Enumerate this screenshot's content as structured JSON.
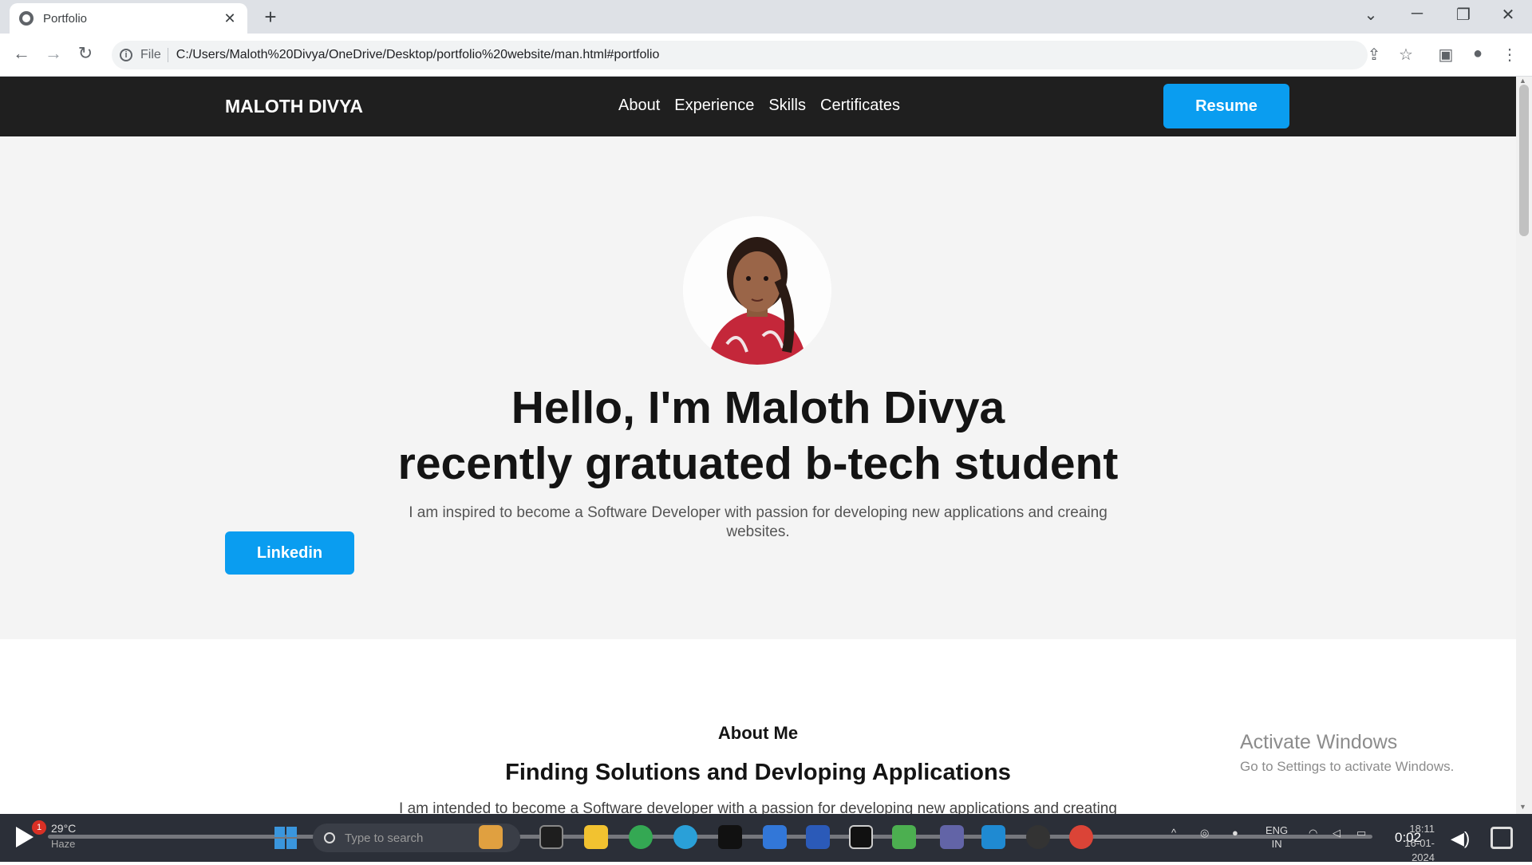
{
  "browser": {
    "tab_title": "Portfolio",
    "url_scheme": "File",
    "url": "C:/Users/Maloth%20Divya/OneDrive/Desktop/portfolio%20website/man.html#portfolio"
  },
  "site": {
    "brand": "MALOTH DIVYA",
    "nav_links": [
      "About",
      "Experience",
      "Skills",
      "Certificates"
    ],
    "resume_label": "Resume"
  },
  "hero": {
    "title_line1": "Hello, I'm Maloth Divya",
    "title_line2": "recently gratuated b-tech student",
    "text": "I am inspired to become a Software Developer with passion for developing new applications and creaing websites.",
    "linkedin_label": "Linkedin"
  },
  "about": {
    "eyebrow": "About Me",
    "title": "Finding Solutions and Devloping Applications",
    "text": "I am intended to become a Software developer with a passion for developing new applications and creating"
  },
  "watermark": {
    "line1": "Activate Windows",
    "line2": "Go to Settings to activate Windows."
  },
  "taskbar": {
    "weather_badge": "1",
    "weather_temp": "29°C",
    "weather_desc": "Haze",
    "search_placeholder": "Type to search",
    "lang_line1": "ENG",
    "lang_line2": "IN",
    "clock_time": "18:11",
    "clock_date": "16-01-2024",
    "video_time": "0:02"
  },
  "colors": {
    "accent": "#0a9df0",
    "nav_bg": "#1f1f1f",
    "hero_bg": "#f4f4f4"
  }
}
